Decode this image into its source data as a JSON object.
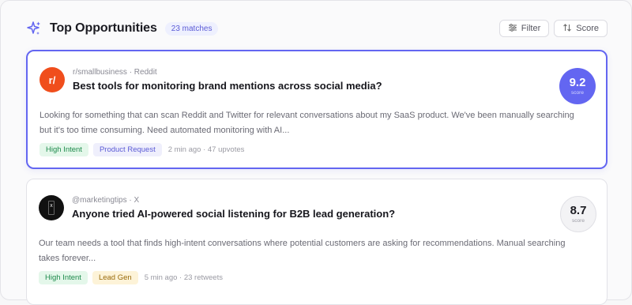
{
  "header": {
    "title": "Top Opportunities",
    "matches": "23 matches",
    "filter_label": "Filter",
    "sort_label": "Score"
  },
  "cards": [
    {
      "avatar": "r/",
      "avatar_color": "#f04e1c",
      "meta": "r/smallbusiness · Reddit",
      "title": "Best tools for monitoring brand mentions across social media?",
      "description": "Looking for something that can scan Reddit and Twitter for relevant conversations about my SaaS product. We've been manually searching but it's too time consuming. Need automated monitoring with AI...",
      "tags": [
        "High Intent",
        "Product Request"
      ],
      "stats": "2 min ago · 47 upvotes",
      "score": "9.2",
      "score_label": "score"
    },
    {
      "avatar": "X",
      "avatar_color": "#111111",
      "meta": "@marketingtips · X",
      "title": "Anyone tried AI-powered social listening for B2B lead generation?",
      "description": "Our team needs a tool that finds high-intent conversations where potential customers are asking for recommendations. Manual searching takes forever...",
      "tags": [
        "High Intent",
        "Lead Gen"
      ],
      "stats": "5 min ago · 23 retweets",
      "score": "8.7",
      "score_label": "score"
    }
  ]
}
